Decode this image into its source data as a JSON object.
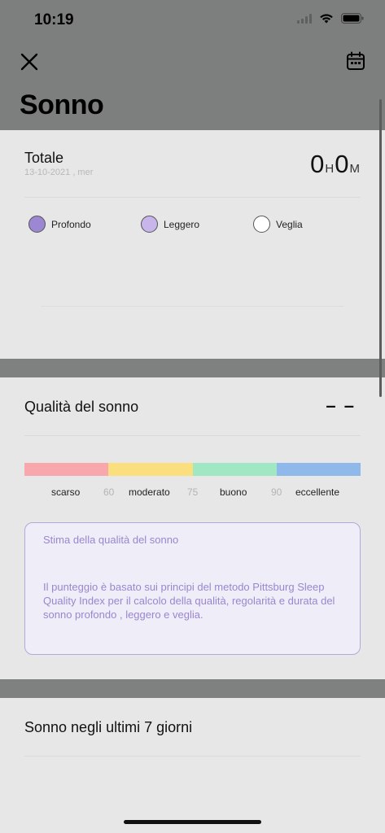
{
  "status_bar": {
    "time": "10:19"
  },
  "nav": {
    "close_icon": "close-icon",
    "calendar_icon": "calendar-icon",
    "title": "Sonno"
  },
  "total": {
    "label": "Totale",
    "date": "13-10-2021 , mer",
    "hours": "0",
    "hours_unit": "H",
    "minutes": "0",
    "minutes_unit": "M"
  },
  "legend": [
    {
      "label": "Profondo",
      "color": "#9c87d3"
    },
    {
      "label": "Leggero",
      "color": "#c7b5ec"
    },
    {
      "label": "Veglia",
      "color": "#ffffff"
    }
  ],
  "quality": {
    "label": "Qualità del sonno",
    "value": "– –",
    "scale_colors": [
      "#f8a7ad",
      "#fbde7d",
      "#9fe8c3",
      "#8fb9eb"
    ],
    "scale_labels": {
      "poor": "scarso",
      "t1": "60",
      "moderate": "moderato",
      "t2": "75",
      "good": "buono",
      "t3": "90",
      "excellent": "eccellente"
    },
    "info_title": "Stima della qualità del sonno",
    "info_body": "Il punteggio è basato sui principi del metodo Pittsburg Sleep Quality Index per il calcolo della qualità, regolarità e durata del sonno profondo , leggero e veglia."
  },
  "week": {
    "label": "Sonno negli ultimi 7 giorni"
  }
}
